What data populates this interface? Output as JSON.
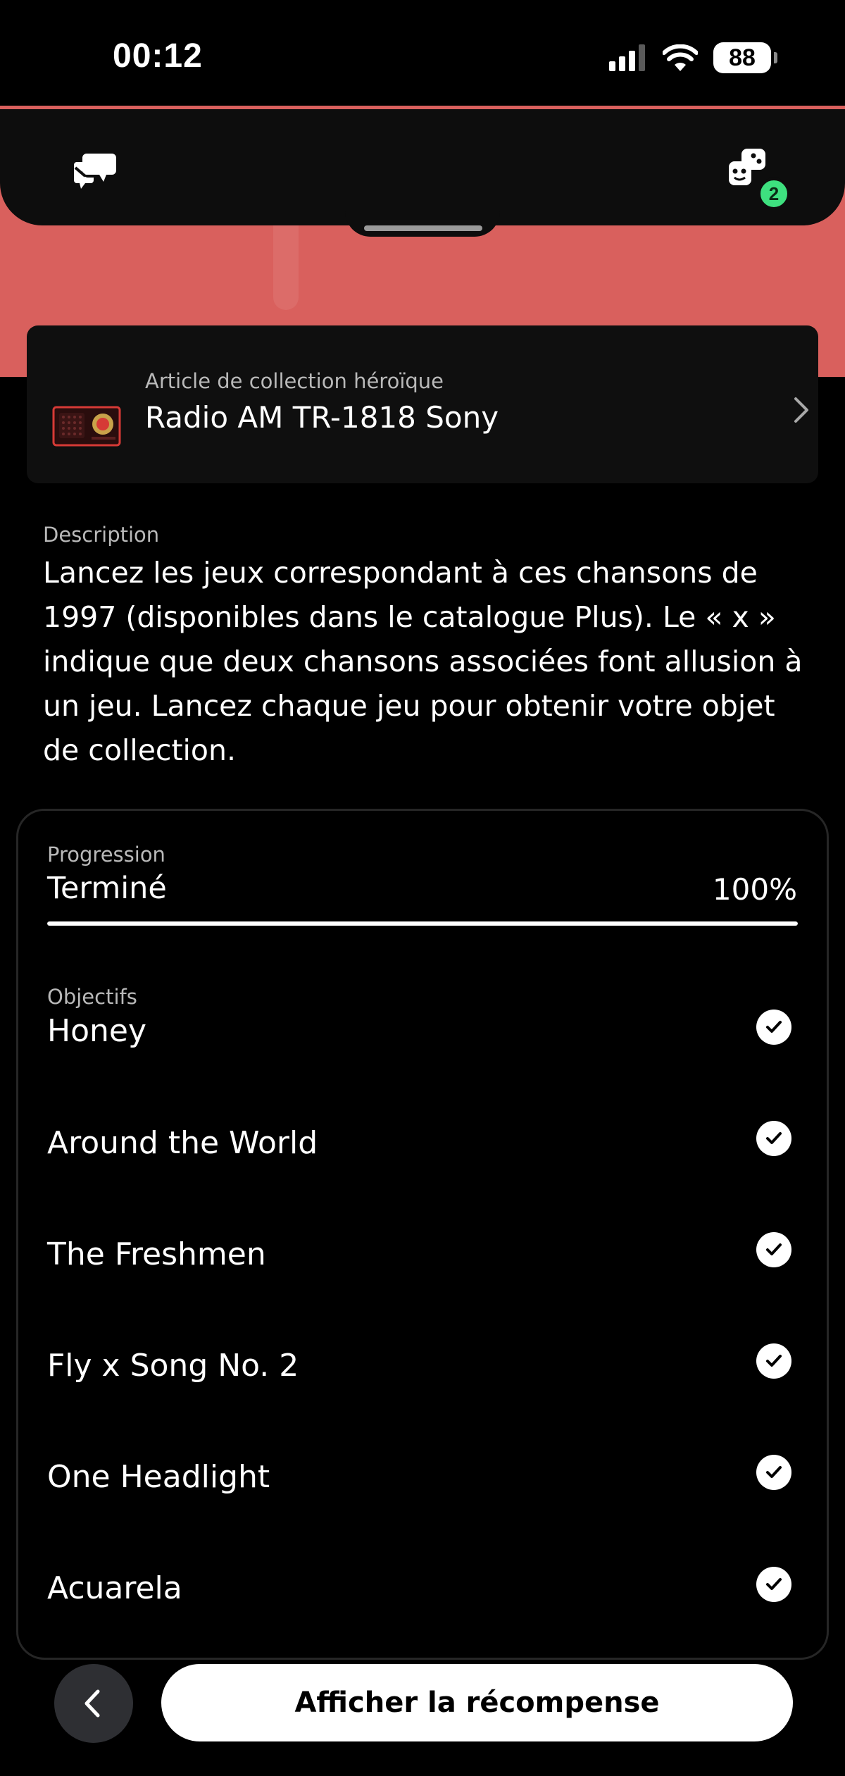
{
  "status_bar": {
    "time": "00:12",
    "battery": "88",
    "icons": [
      "cellular-signal-icon",
      "wifi-icon",
      "battery-icon"
    ]
  },
  "header": {
    "icons": [
      "chat-bubbles-icon",
      "game-pieces-icon"
    ],
    "notification_count": "2"
  },
  "collection": {
    "caption": "Article de collection héroïque",
    "title": "Radio AM TR-1818 Sony"
  },
  "description": {
    "label": "Description",
    "text": "Lancez les jeux correspondant à ces chansons de 1997 (disponibles dans le catalogue Plus). Le « x » indique que deux chansons associées font allusion à un jeu. Lancez chaque jeu pour obtenir votre objet de collection."
  },
  "progress": {
    "label": "Progression",
    "status": "Terminé",
    "percent_text": "100%",
    "value": 1.0
  },
  "objectives": {
    "label": "Objectifs",
    "items": [
      {
        "title": "Honey",
        "completed": true
      },
      {
        "title": "Around the World",
        "completed": true
      },
      {
        "title": "The Freshmen",
        "completed": true
      },
      {
        "title": "Fly x Song No. 2",
        "completed": true
      },
      {
        "title": "One Headlight",
        "completed": true
      },
      {
        "title": "Acuarela",
        "completed": true
      }
    ]
  },
  "footer": {
    "reward_button": "Afficher la récompense"
  },
  "colors": {
    "hero": "#d9605d",
    "badge": "#3ee07f",
    "background": "#000000"
  }
}
